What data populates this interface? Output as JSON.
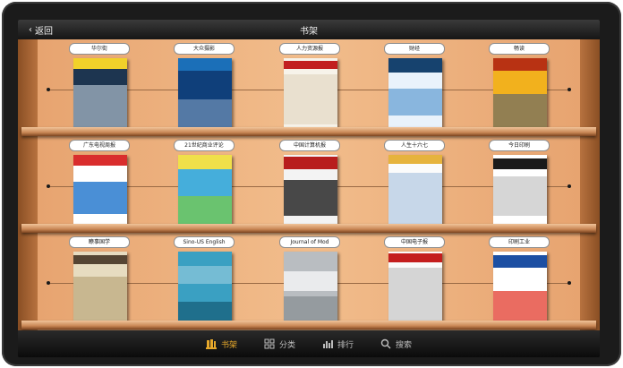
{
  "header": {
    "back_label": "返回",
    "title": "书架"
  },
  "shelves": [
    {
      "items": [
        {
          "label": "华尔街",
          "colors": [
            "#1d3550",
            "#c7d3df",
            "#f1d12a"
          ]
        },
        {
          "label": "大众摄影",
          "colors": [
            "#0f3f7a",
            "#1b6fb8",
            "#d8e6f6"
          ]
        },
        {
          "label": "人力资源报",
          "colors": [
            "#f7f3ea",
            "#c21f1f",
            "#e9e0cf"
          ]
        },
        {
          "label": "财经",
          "colors": [
            "#16426e",
            "#e9f2fb",
            "#2a7ac2"
          ]
        },
        {
          "label": "畅读",
          "colors": [
            "#f2b11d",
            "#b83213",
            "#6a6a6a"
          ]
        }
      ]
    },
    {
      "items": [
        {
          "label": "广东电视周报",
          "colors": [
            "#ffffff",
            "#d92d2d",
            "#4a8fd6"
          ]
        },
        {
          "label": "21世纪商业评论",
          "colors": [
            "#45aedb",
            "#f0e04a",
            "#6ac36f"
          ]
        },
        {
          "label": "中国计算机报",
          "colors": [
            "#f3f3f3",
            "#b81d1d",
            "#1d1d1d"
          ]
        },
        {
          "label": "人生十六七",
          "colors": [
            "#fbfbfb",
            "#e6b33d",
            "#2a6db4"
          ]
        },
        {
          "label": "今日印刷",
          "colors": [
            "#ffffff",
            "#1a1a1a",
            "#d6d6d6"
          ]
        }
      ]
    },
    {
      "items": [
        {
          "label": "瞭事国学",
          "colors": [
            "#e7dcc0",
            "#3b2a1a",
            "#c8b790"
          ]
        },
        {
          "label": "Sino-US English",
          "colors": [
            "#3aa0c2",
            "#e4f2f7",
            "#1f6f8c"
          ]
        },
        {
          "label": "Journal of Mod",
          "colors": [
            "#b9bdc1",
            "#ffffff",
            "#7d8389"
          ]
        },
        {
          "label": "中国电子报",
          "colors": [
            "#fafafa",
            "#c41e1e",
            "#2f2f2f"
          ]
        },
        {
          "label": "印刷工业",
          "colors": [
            "#ffffff",
            "#1c4fa3",
            "#e33b2c"
          ]
        }
      ]
    }
  ],
  "tabbar": {
    "tabs": [
      {
        "label": "书架",
        "icon": "bookshelf-icon",
        "active": true
      },
      {
        "label": "分类",
        "icon": "grid-icon",
        "active": false
      },
      {
        "label": "排行",
        "icon": "bar-chart-icon",
        "active": false
      },
      {
        "label": "搜索",
        "icon": "search-icon",
        "active": false
      }
    ]
  },
  "accent_color": "#e6a82b"
}
